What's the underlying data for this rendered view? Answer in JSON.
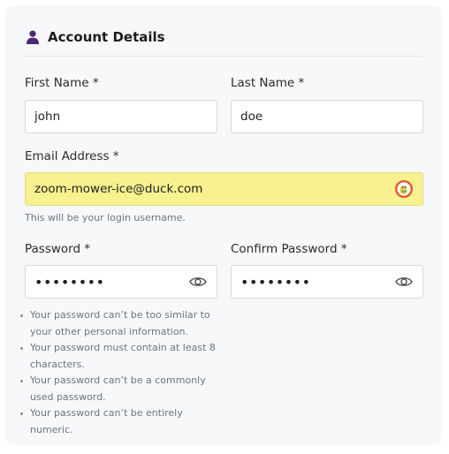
{
  "header": {
    "title": "Account Details",
    "icon": "user-icon",
    "icon_color": "#4a2a6e"
  },
  "first_name": {
    "label": "First Name *",
    "value": "john"
  },
  "last_name": {
    "label": "Last Name *",
    "value": "doe"
  },
  "email": {
    "label": "Email Address *",
    "value": "zoom-mower-ice@duck.com",
    "help": "This will be your login username.",
    "autofill_color": "#f7f18f",
    "autofill_icon": "duckduckgo-icon"
  },
  "password": {
    "label": "Password *",
    "value": "••••••••",
    "toggle_icon": "eye-icon"
  },
  "confirm_password": {
    "label": "Confirm Password *",
    "value": "••••••••",
    "toggle_icon": "eye-icon"
  },
  "password_rules": [
    "Your password can’t be too similar to your other personal information.",
    "Your password must contain at least 8 characters.",
    "Your password can’t be a commonly used password.",
    "Your password can’t be entirely numeric."
  ]
}
